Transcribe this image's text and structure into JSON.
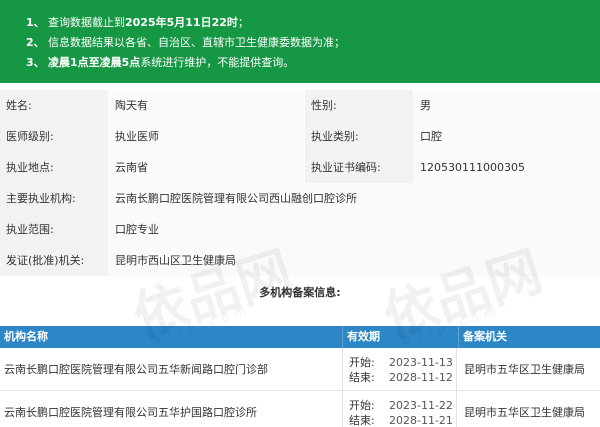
{
  "notice": {
    "lines": [
      {
        "num": "1、",
        "pre": "查询数据截止到",
        "bold": "2025年5月11日22时",
        "post": "；"
      },
      {
        "num": "2、",
        "pre": "信息数据结果以各省、自治区、直辖市卫生健康委数据为准；",
        "bold": "",
        "post": ""
      },
      {
        "num": "3、",
        "pre": "",
        "bold": "凌晨1点至凌晨5点",
        "post": "系统进行维护，不能提供查询。"
      }
    ]
  },
  "info": {
    "name_label": "姓名:",
    "name_value": "陶天有",
    "gender_label": "性别:",
    "gender_value": "男",
    "level_label": "医师级别:",
    "level_value": "执业医师",
    "category_label": "执业类别:",
    "category_value": "口腔",
    "location_label": "执业地点:",
    "location_value": "云南省",
    "cert_label": "执业证书编码:",
    "cert_value": "120530111000305",
    "org_label": "主要执业机构:",
    "org_value": "云南长鹏口腔医院管理有限公司西山融创口腔诊所",
    "scope_label": "执业范围:",
    "scope_value": "口腔专业",
    "issuer_label": "发证(批准)机关:",
    "issuer_value": "昆明市西山区卫生健康局"
  },
  "section_title": "多机构备案信息:",
  "records": {
    "headers": {
      "name": "机构名称",
      "valid": "有效期",
      "org": "备案机关"
    },
    "rows": [
      {
        "name": "云南长鹏口腔医院管理有限公司五华新闻路口腔门诊部",
        "start_label": "开始:",
        "start": "2023-11-13",
        "end_label": "结束:",
        "end": "2028-11-12",
        "org": "昆明市五华区卫生健康局"
      },
      {
        "name": "云南长鹏口腔医院管理有限公司五华护国路口腔诊所",
        "start_label": "开始:",
        "start": "2023-11-22",
        "end_label": "结束:",
        "end": "2028-11-21",
        "org": "昆明市五华区卫生健康局"
      }
    ]
  },
  "watermark": {
    "text": "依品网",
    "sub": "87ip.com"
  },
  "colors": {
    "banner": "#169744",
    "table_header": "#2d86c6",
    "label_bg": "#f2f2f2"
  }
}
